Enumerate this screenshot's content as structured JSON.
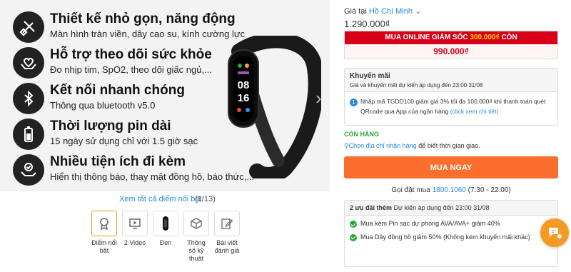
{
  "features": [
    {
      "title": "Thiết kế nhỏ gọn, năng động",
      "subtitle": "Màn hình tràn viền, dây cao su, kính cường lực",
      "icon": "design-tools-icon"
    },
    {
      "title": "Hỗ trợ theo dõi sức khỏe",
      "subtitle": "Đo nhịp tim, SpO2, theo dõi giấc ngủ,...",
      "icon": "heart-hands-icon"
    },
    {
      "title": "Kết nối nhanh chóng",
      "subtitle": "Thông qua bluetooth v5.0",
      "icon": "bluetooth-icon"
    },
    {
      "title": "Thời lượng pin dài",
      "subtitle": "15 ngày sử dụng chỉ với 1.5 giờ sạc",
      "icon": "battery-icon"
    },
    {
      "title": "Nhiều tiện ích đi kèm",
      "subtitle": "Hiển thị thông báo, thay mặt đồng hồ, báo thức,...",
      "icon": "hand-check-icon"
    }
  ],
  "watch_screen": {
    "time_hour": "08",
    "time_min": "16"
  },
  "gallery": {
    "view_all": "Xem tất cả điểm nổi bật",
    "counter": "(1/13)",
    "thumbs": [
      {
        "label": "Điểm nổi bật",
        "icon": "award-icon"
      },
      {
        "label": "2 Video",
        "icon": "video-icon"
      },
      {
        "label": "Đen",
        "icon": "black-band-icon"
      },
      {
        "label": "Thông số kỹ thuật",
        "icon": "cube-icon"
      },
      {
        "label": "Bài viết đánh giá",
        "icon": "edit-icon"
      }
    ]
  },
  "pricing": {
    "location_prefix": "Giá tại",
    "location": "Hồ Chí Minh",
    "price": "1.290.000₫",
    "online_label": "MUA ONLINE GIẢM SỐC",
    "online_discount": "300.000₫",
    "online_suffix": "CÒN",
    "online_price": "990.000₫"
  },
  "promotion": {
    "title": "Khuyến mãi",
    "subtitle": "Giá và khuyến mãi dự kiến áp dụng đến 23:00 31/08",
    "item_number": "1",
    "item_text": "Nhập mã TGDD100 giảm giá 3% tối đa 100.000₫ khi thanh toán quét QRcode qua App của ngân hàng",
    "item_link": "(click xem chi tiết)"
  },
  "stock": {
    "status": "CÒN HÀNG",
    "address_link": "Chọn địa chỉ nhận hàng",
    "address_suffix": "để biết thời gian giao."
  },
  "buy_button": "MUA NGAY",
  "call": {
    "prefix": "Gọi đặt mua",
    "phone": "1800.1060",
    "hours": "(7:30 - 22:00)"
  },
  "extra_offers": {
    "title": "2 ưu đãi thêm",
    "subtitle": "Dự kiến áp dụng đến 23:00 31/08",
    "items": [
      "Mua kèm Pin sạc dự phòng AVA/AVA+ giảm 40%",
      "Mua Dây đồng hồ giảm 50% (Không kèm khuyến mãi khác)"
    ]
  },
  "colors": {
    "accent": "#fb6e2e",
    "red": "#d70018",
    "link": "#288ad6",
    "green": "#2ba832"
  }
}
